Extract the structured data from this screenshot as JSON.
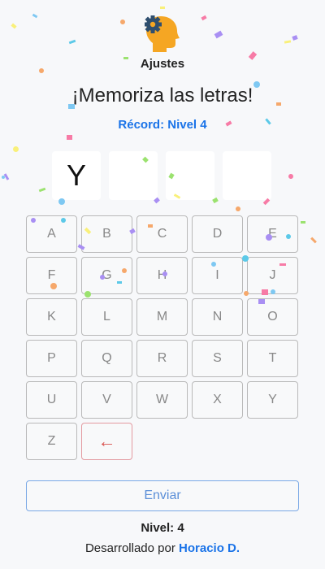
{
  "settings": {
    "label": "Ajustes",
    "icon": "head-gear-icon"
  },
  "title": "¡Memoriza las letras!",
  "record": "Récord: Nivel 4",
  "slots": [
    "Y",
    "",
    "",
    ""
  ],
  "keyboard": {
    "keys": [
      "A",
      "B",
      "C",
      "D",
      "E",
      "F",
      "G",
      "H",
      "I",
      "J",
      "K",
      "L",
      "M",
      "N",
      "O",
      "P",
      "Q",
      "R",
      "S",
      "T",
      "U",
      "V",
      "W",
      "X",
      "Y",
      "Z"
    ],
    "backspace": "←"
  },
  "submit_label": "Enviar",
  "level": "Nivel: 4",
  "credit": {
    "prefix": "Desarrollado por ",
    "author": "Horacio D."
  },
  "colors": {
    "accent": "#1a73e8",
    "key_border": "#b9b9b9",
    "backspace": "#d9534f",
    "head": "#f5a623",
    "gear": "#2f4f6f",
    "confetti": [
      "#7ec8f2",
      "#f77ba6",
      "#a98ff3",
      "#f9f07a",
      "#9be26f",
      "#f6a86b",
      "#5cc9e8"
    ]
  }
}
